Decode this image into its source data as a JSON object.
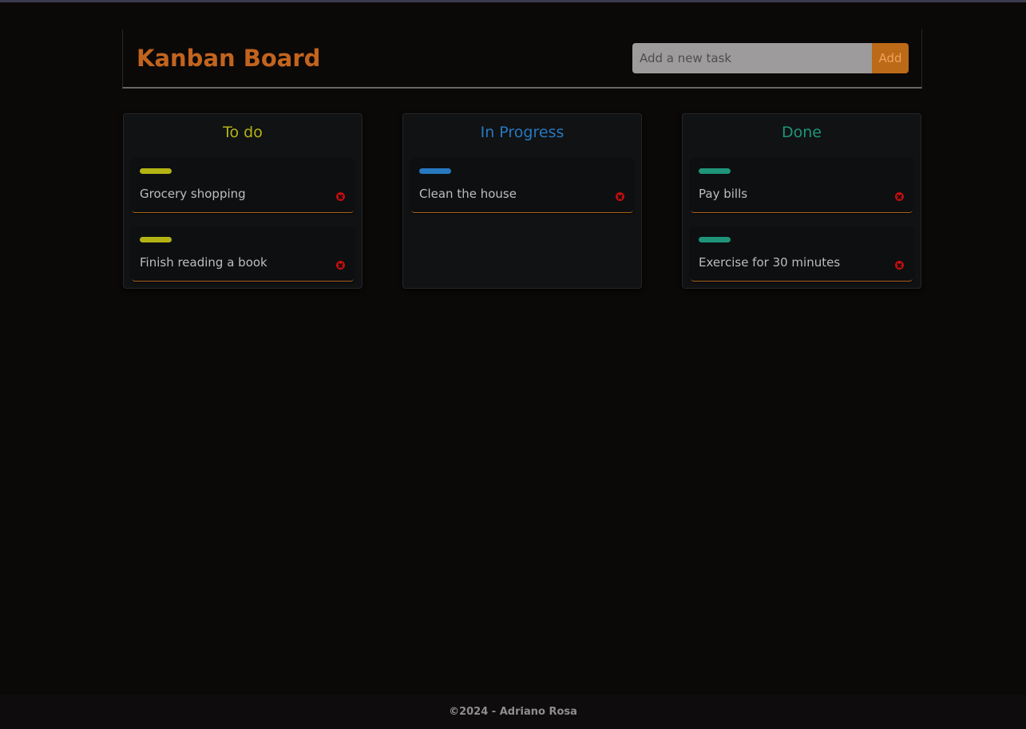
{
  "header": {
    "title": "Kanban Board",
    "input_placeholder": "Add a new task",
    "add_label": "Add"
  },
  "colors": {
    "accent": "#c2641e",
    "todo": "#b3b314",
    "in_progress": "#2878bf",
    "done": "#1f9479",
    "remove": "#c00e0e"
  },
  "columns": [
    {
      "title": "To do",
      "color": "#b3b314",
      "cards": [
        {
          "label": "Grocery shopping",
          "icon": "remove-icon"
        },
        {
          "label": "Finish reading a book",
          "icon": "remove-icon"
        }
      ]
    },
    {
      "title": "In Progress",
      "color": "#2878bf",
      "cards": [
        {
          "label": "Clean the house",
          "icon": "remove-icon"
        }
      ]
    },
    {
      "title": "Done",
      "color": "#1f9479",
      "cards": [
        {
          "label": "Pay bills",
          "icon": "remove-icon"
        },
        {
          "label": "Exercise for 30 minutes",
          "icon": "remove-icon"
        }
      ]
    }
  ],
  "footer": {
    "text": "©2024 - Adriano Rosa"
  }
}
